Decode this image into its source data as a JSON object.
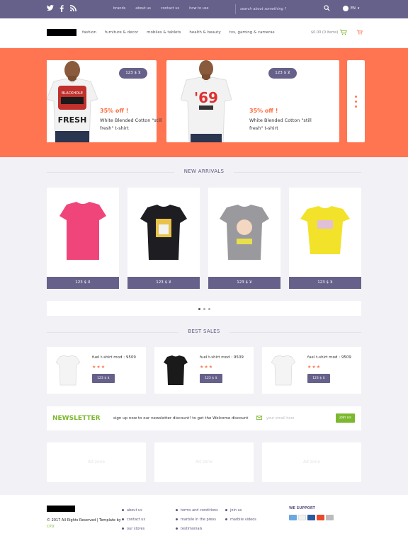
{
  "topbar": {
    "nav": [
      "brands",
      "about us",
      "contact us",
      "how to use"
    ],
    "search_placeholder": "search about something ?",
    "lang": "EN"
  },
  "header": {
    "nav": [
      "fashion",
      "furniture & decor",
      "mobiles & tablets",
      "health & beauty",
      "tvs, gaming & cameras"
    ],
    "cart_total": "$0.00 (0 items)"
  },
  "hero": {
    "slides": [
      {
        "price": "123 $",
        "discount": "35% off !",
        "title": "White Blended Cotton \"still fresh\" t-shirt",
        "shirt_text": "FRESH"
      },
      {
        "price": "123 $",
        "discount": "35% off !",
        "title": "White Blended Cotton \"still fresh\" t-shirt",
        "shirt_text": "'69"
      }
    ]
  },
  "new_arrivals": {
    "title": "NEW ARRIVALS",
    "products": [
      {
        "price": "123 $",
        "color": "#f0457a"
      },
      {
        "price": "123 $",
        "color": "#1e1e22"
      },
      {
        "price": "123 $",
        "color": "#9a9a9e"
      },
      {
        "price": "123 $",
        "color": "#f2e22a"
      }
    ]
  },
  "best_sales": {
    "title": "BEST SALES",
    "items": [
      {
        "name": "fuel t-shirt mod : 9509",
        "stars": "★★★",
        "price": "123 $",
        "color": "#f4f4f4"
      },
      {
        "name": "fuel t-shirt mod : 9509",
        "stars": "★★★",
        "price": "123 $",
        "color": "#1a1a1a"
      },
      {
        "name": "fuel t-shirt mod : 9509",
        "stars": "★★★",
        "price": "123 $",
        "color": "#f4f4f4"
      }
    ]
  },
  "newsletter": {
    "title": "NEWSLETTER",
    "text": "sign up now to our newsletter discount! to get the Welcome discount",
    "placeholder": "your email here",
    "button": "join us"
  },
  "ads": [
    "Ad zone",
    "Ad zone",
    "Ad zone"
  ],
  "footer": {
    "copyright": "© 2017 All Rights Reserved | Template by",
    "author": "CPD",
    "col1": [
      "about us",
      "contact us",
      "our stores"
    ],
    "col2": [
      "terms and conditions",
      "marbile in the press",
      "testimonials"
    ],
    "col3": [
      "join us",
      "marbile videos"
    ],
    "support_title": "WE SUPPORT"
  },
  "colors": {
    "accent": "#66618a",
    "hero_bg": "#ff7551",
    "green": "#7cb82f"
  }
}
